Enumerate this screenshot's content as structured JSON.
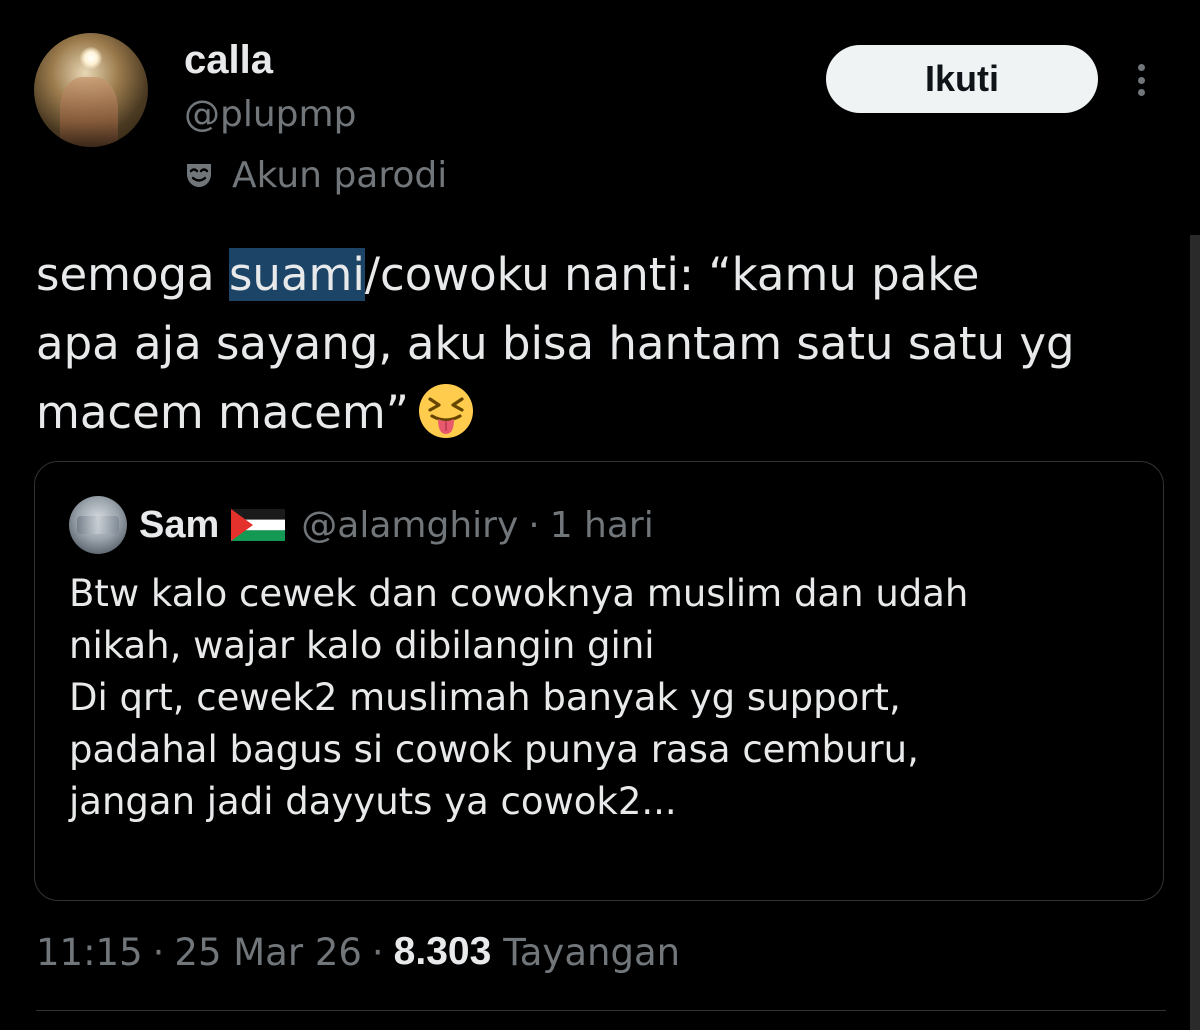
{
  "author": {
    "name": "calla",
    "handle": "@plupmp",
    "label": "Akun parodi"
  },
  "follow_label": "Ikuti",
  "tweet": {
    "text_before": "semoga ",
    "text_highlight": "suami",
    "text_after": "/cowoku nanti: “kamu pake\napa aja sayang, aku bisa hantam satu satu yg\nmacem macem”"
  },
  "quote": {
    "name": "Sam",
    "handle": "@alamghiry",
    "dot": "·",
    "time": "1 hari",
    "text": "Btw kalo cewek dan cowoknya muslim dan udah\nnikah, wajar kalo dibilangin gini\nDi qrt, cewek2 muslimah banyak yg support,\npadahal bagus si cowok punya rasa cemburu,\njangan jadi dayyuts ya cowok2..."
  },
  "meta": {
    "time": "11:15",
    "date": "25 Mar 26",
    "sep": "·",
    "views_count": "8.303",
    "views_label": "Tayangan"
  },
  "icons": {
    "parody": "mask-icon",
    "emoji": "squinting-face-with-tongue",
    "flag": "palestine-flag",
    "more": "more-vertical-icon"
  },
  "colors": {
    "background": "#000000",
    "text": "#e7e9ea",
    "muted": "#71767b",
    "follow_bg": "#eff3f4",
    "highlight": "#1c4466",
    "border": "#2f3336"
  }
}
